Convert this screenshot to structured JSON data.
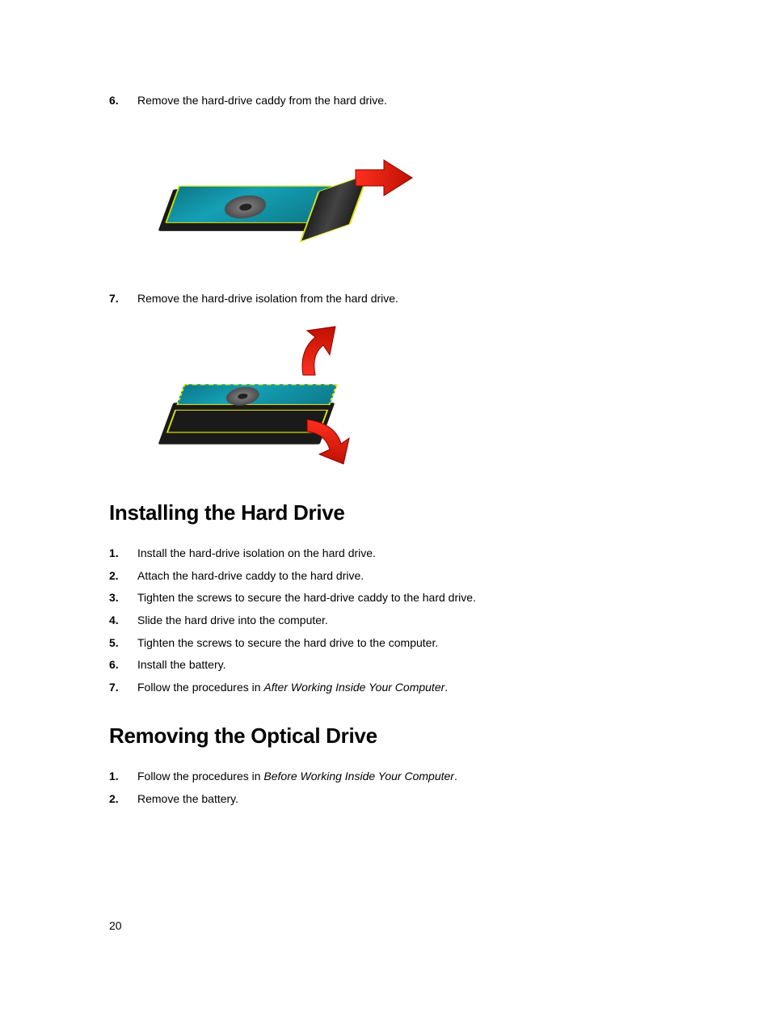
{
  "removing_steps": [
    {
      "num": "6.",
      "text": "Remove the hard-drive caddy from the hard drive."
    },
    {
      "num": "7.",
      "text": "Remove the hard-drive isolation from the hard drive."
    }
  ],
  "section1": {
    "heading": "Installing the Hard Drive",
    "steps": [
      {
        "num": "1.",
        "text": "Install the hard-drive isolation on the hard drive."
      },
      {
        "num": "2.",
        "text": "Attach the hard-drive caddy to the hard drive."
      },
      {
        "num": "3.",
        "text": "Tighten the screws to secure the hard-drive caddy to the hard drive."
      },
      {
        "num": "4.",
        "text": "Slide the hard drive into the computer."
      },
      {
        "num": "5.",
        "text": "Tighten the screws to secure the hard drive to the computer."
      },
      {
        "num": "6.",
        "text": "Install the battery."
      },
      {
        "num": "7.",
        "text_prefix": "Follow the procedures in ",
        "italic": "After Working Inside Your Computer",
        "text_suffix": "."
      }
    ]
  },
  "section2": {
    "heading": "Removing the Optical Drive",
    "steps": [
      {
        "num": "1.",
        "text_prefix": "Follow the procedures in ",
        "italic": "Before Working Inside Your Computer",
        "text_suffix": "."
      },
      {
        "num": "2.",
        "text": "Remove the battery."
      }
    ]
  },
  "page_number": "20"
}
